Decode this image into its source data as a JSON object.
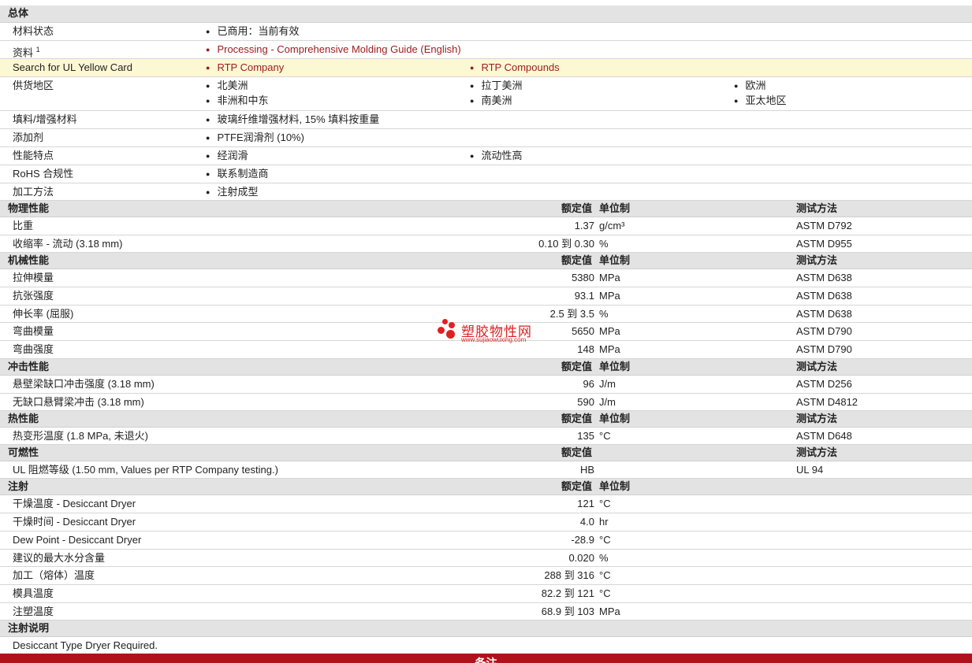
{
  "general": {
    "header": "总体",
    "material_status": {
      "label": "材料状态",
      "value": "已商用：当前有效"
    },
    "literature": {
      "label": "资料",
      "sup": "1",
      "link": "Processing - Comprehensive Molding Guide (English)"
    },
    "ul_card": {
      "label": "Search for UL Yellow Card",
      "link1": "RTP Company",
      "link2": "RTP Compounds"
    },
    "regions": {
      "label": "供货地区",
      "items": [
        "北美洲",
        "拉丁美洲",
        "欧洲",
        "非洲和中东",
        "南美洲",
        "亚太地区"
      ]
    },
    "filler": {
      "label": "填料/增强材料",
      "value": "玻璃纤维增强材料, 15% 填料按重量"
    },
    "additive": {
      "label": "添加剂",
      "value": "PTFE润滑剂 (10%)"
    },
    "features": {
      "label": "性能特点",
      "items": [
        "经润滑",
        "流动性高"
      ]
    },
    "rohs": {
      "label": "RoHS 合规性",
      "value": "联系制造商"
    },
    "processing": {
      "label": "加工方法",
      "value": "注射成型"
    }
  },
  "col_headers": {
    "nominal": "额定值",
    "unit": "单位制",
    "method": "测试方法"
  },
  "physical": {
    "header": "物理性能",
    "rows": [
      {
        "label": "比重",
        "value": "1.37",
        "unit": "g/cm³",
        "method": "ASTM D792"
      },
      {
        "label": "收缩率  - 流动  (3.18 mm)",
        "value": "0.10 到  0.30",
        "unit": "%",
        "method": "ASTM D955"
      }
    ]
  },
  "mechanical": {
    "header": "机械性能",
    "rows": [
      {
        "label": "拉伸模量",
        "value": "5380",
        "unit": "MPa",
        "method": "ASTM D638"
      },
      {
        "label": "抗张强度",
        "value": "93.1",
        "unit": "MPa",
        "method": "ASTM D638"
      },
      {
        "label": "伸长率  (屈服)",
        "value": "2.5 到  3.5",
        "unit": "%",
        "method": "ASTM D638"
      },
      {
        "label": "弯曲模量",
        "value": "5650",
        "unit": "MPa",
        "method": "ASTM D790"
      },
      {
        "label": "弯曲强度",
        "value": "148",
        "unit": "MPa",
        "method": "ASTM D790"
      }
    ]
  },
  "impact": {
    "header": "冲击性能",
    "rows": [
      {
        "label": "悬壁梁缺口冲击强度  (3.18 mm)",
        "value": "96",
        "unit": "J/m",
        "method": "ASTM D256"
      },
      {
        "label": "无缺口悬臂梁冲击  (3.18 mm)",
        "value": "590",
        "unit": "J/m",
        "method": "ASTM D4812"
      }
    ]
  },
  "thermal": {
    "header": "热性能",
    "rows": [
      {
        "label": "热变形温度  (1.8 MPa, 未退火)",
        "value": "135",
        "unit": "°C",
        "method": "ASTM D648"
      }
    ]
  },
  "flammability": {
    "header": "可燃性",
    "rows": [
      {
        "label": "UL 阻燃等级  (1.50 mm, Values per RTP Company testing.)",
        "value": "HB",
        "unit": "",
        "method": "UL 94"
      }
    ]
  },
  "injection": {
    "header": "注射",
    "rows": [
      {
        "label": "干燥温度  - Desiccant Dryer",
        "value": "121",
        "unit": "°C"
      },
      {
        "label": "干燥时间  - Desiccant Dryer",
        "value": "4.0",
        "unit": "hr"
      },
      {
        "label": "Dew Point - Desiccant Dryer",
        "value": "-28.9",
        "unit": "°C"
      },
      {
        "label": "建议的最大水分含量",
        "value": "0.020",
        "unit": "%"
      },
      {
        "label": "加工（熔体）温度",
        "value": "288 到  316",
        "unit": "°C"
      },
      {
        "label": "模具温度",
        "value": "82.2 到  121",
        "unit": "°C"
      },
      {
        "label": "注塑温度",
        "value": "68.9 到  103",
        "unit": "MPa"
      }
    ]
  },
  "notes": {
    "header": "注射说明",
    "text": "Desiccant Type Dryer Required."
  },
  "footer": {
    "label": "备注"
  },
  "watermark": {
    "title": "塑胶物性网",
    "url": "www.sujiaowuxing.com"
  },
  "colors": {
    "link": "#9b1b1b",
    "section_bg": "#e3e3e3",
    "highlight": "#fdf8d4",
    "footer": "#b0121b"
  }
}
